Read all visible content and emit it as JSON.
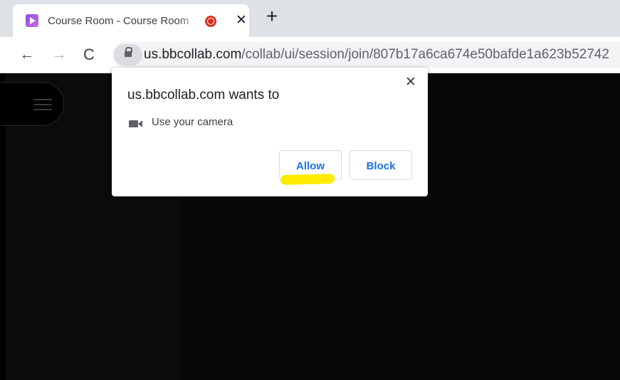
{
  "tab": {
    "title": "Course Room - Course Room",
    "close_glyph": "✕"
  },
  "tabstrip": {
    "new_tab_glyph": "+"
  },
  "toolbar": {
    "back_glyph": "←",
    "forward_glyph": "→",
    "reload_glyph": "C",
    "url_domain": "us.bbcollab.com",
    "url_path": "/collab/ui/session/join/807b17a6ca674e50bafde1a623b52742"
  },
  "dialog": {
    "title": "us.bbcollab.com wants to",
    "permission": "Use your camera",
    "allow_label": "Allow",
    "block_label": "Block",
    "close_glyph": "✕"
  },
  "colors": {
    "accent": "#1a73e8",
    "highlight": "#ffeb00",
    "recording": "#d93025"
  },
  "icons": [
    "favicon-icon",
    "recording-icon",
    "close-icon",
    "plus-icon",
    "back-arrow-icon",
    "forward-arrow-icon",
    "reload-icon",
    "lock-icon",
    "camera-icon",
    "hamburger-menu-icon"
  ]
}
